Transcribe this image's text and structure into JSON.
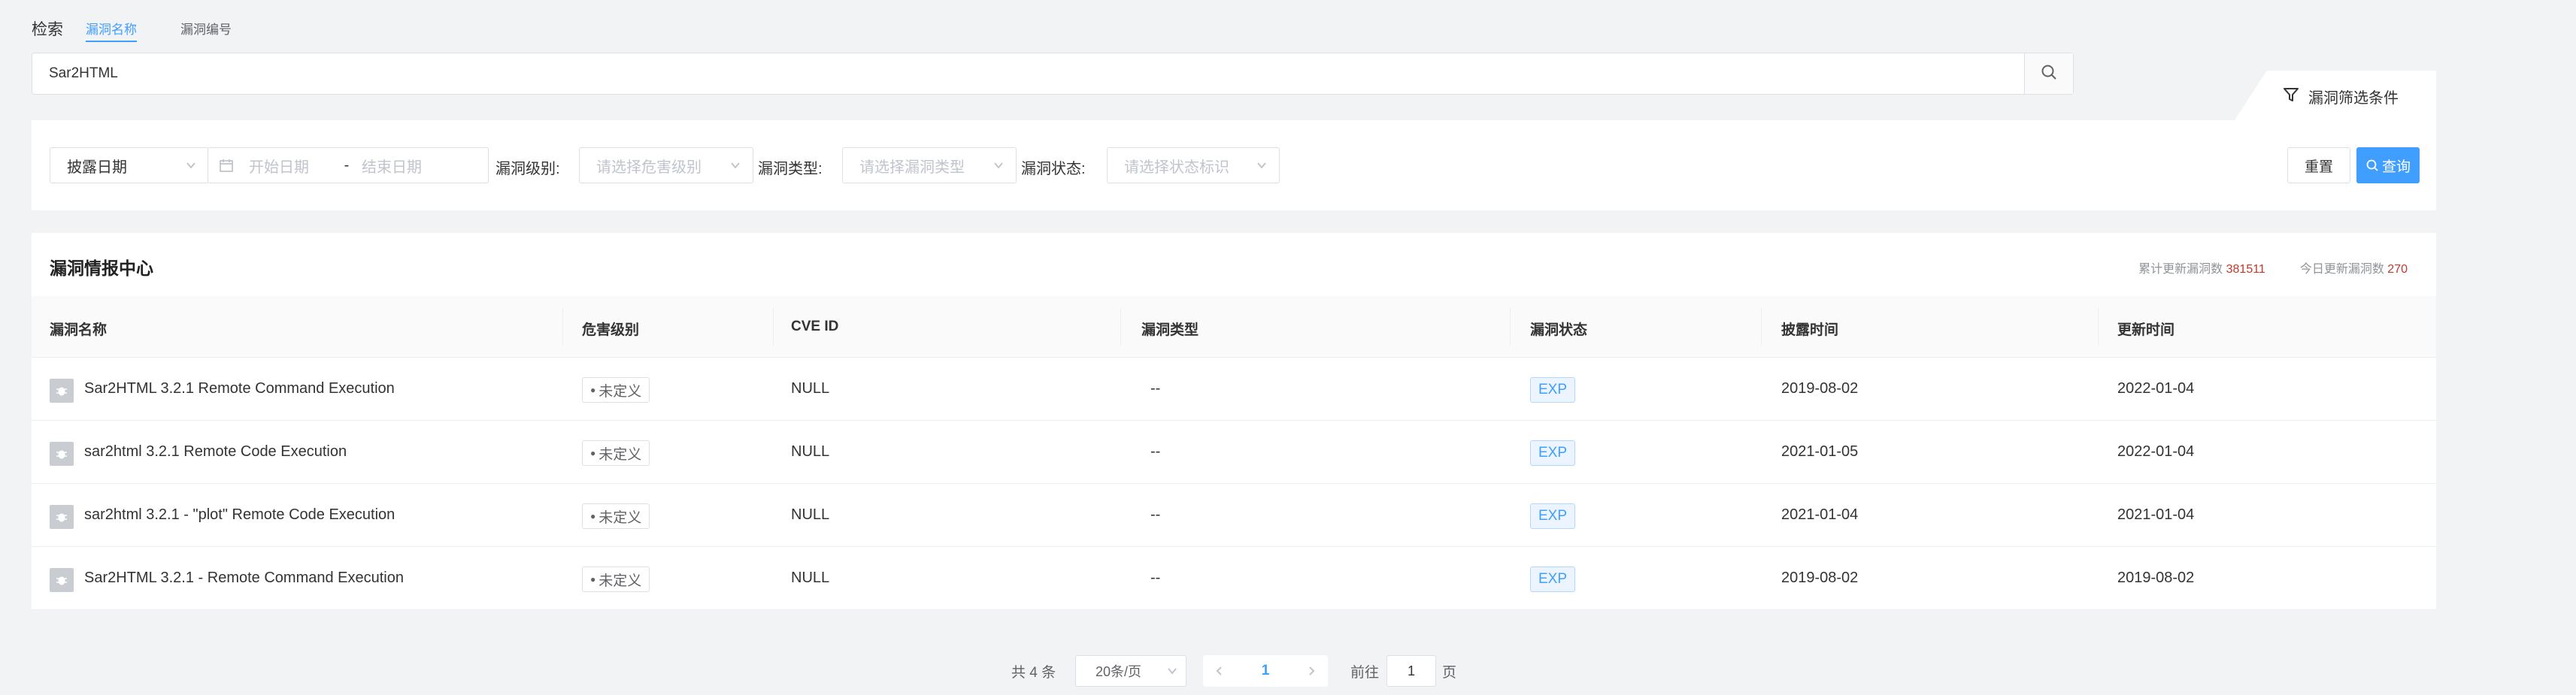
{
  "tabs": {
    "lead": "检索",
    "items": [
      "漏洞名称",
      "漏洞编号"
    ]
  },
  "search": {
    "value": "Sar2HTML",
    "icon": "search-icon"
  },
  "filter_tab": {
    "label": "漏洞筛选条件",
    "icon": "funnel-icon"
  },
  "filters": {
    "date_type": "披露日期",
    "start_placeholder": "开始日期",
    "separator": "-",
    "end_placeholder": "结束日期",
    "level_label": "漏洞级别:",
    "level_placeholder": "请选择危害级别",
    "type_label": "漏洞类型:",
    "type_placeholder": "请选择漏洞类型",
    "status_label": "漏洞状态:",
    "status_placeholder": "请选择状态标识",
    "reset": "重置",
    "query": "查询"
  },
  "card": {
    "title": "漏洞情报中心",
    "total_label": "累计更新漏洞数",
    "total_value": "381511",
    "today_label": "今日更新漏洞数",
    "today_value": "270"
  },
  "columns": [
    "漏洞名称",
    "危害级别",
    "CVE ID",
    "漏洞类型",
    "漏洞状态",
    "披露时间",
    "更新时间"
  ],
  "rows": [
    {
      "name": "Sar2HTML 3.2.1 Remote Command Execution",
      "level": "未定义",
      "cve": "NULL",
      "type": "--",
      "status": "EXP",
      "disclosed": "2019-08-02",
      "updated": "2022-01-04"
    },
    {
      "name": "sar2html 3.2.1 Remote Code Execution",
      "level": "未定义",
      "cve": "NULL",
      "type": "--",
      "status": "EXP",
      "disclosed": "2021-01-05",
      "updated": "2022-01-04"
    },
    {
      "name": "sar2html 3.2.1 - \"plot\" Remote Code Execution",
      "level": "未定义",
      "cve": "NULL",
      "type": "--",
      "status": "EXP",
      "disclosed": "2021-01-04",
      "updated": "2021-01-04"
    },
    {
      "name": "Sar2HTML 3.2.1 - Remote Command Execution",
      "level": "未定义",
      "cve": "NULL",
      "type": "--",
      "status": "EXP",
      "disclosed": "2019-08-02",
      "updated": "2019-08-02"
    }
  ],
  "pagination": {
    "total": "共 4 条",
    "page_size": "20条/页",
    "current": "1",
    "goto_label": "前往",
    "goto_value": "1",
    "page_suffix": "页"
  },
  "colors": {
    "accent": "#409eff",
    "stat_number": "#c0392b"
  }
}
